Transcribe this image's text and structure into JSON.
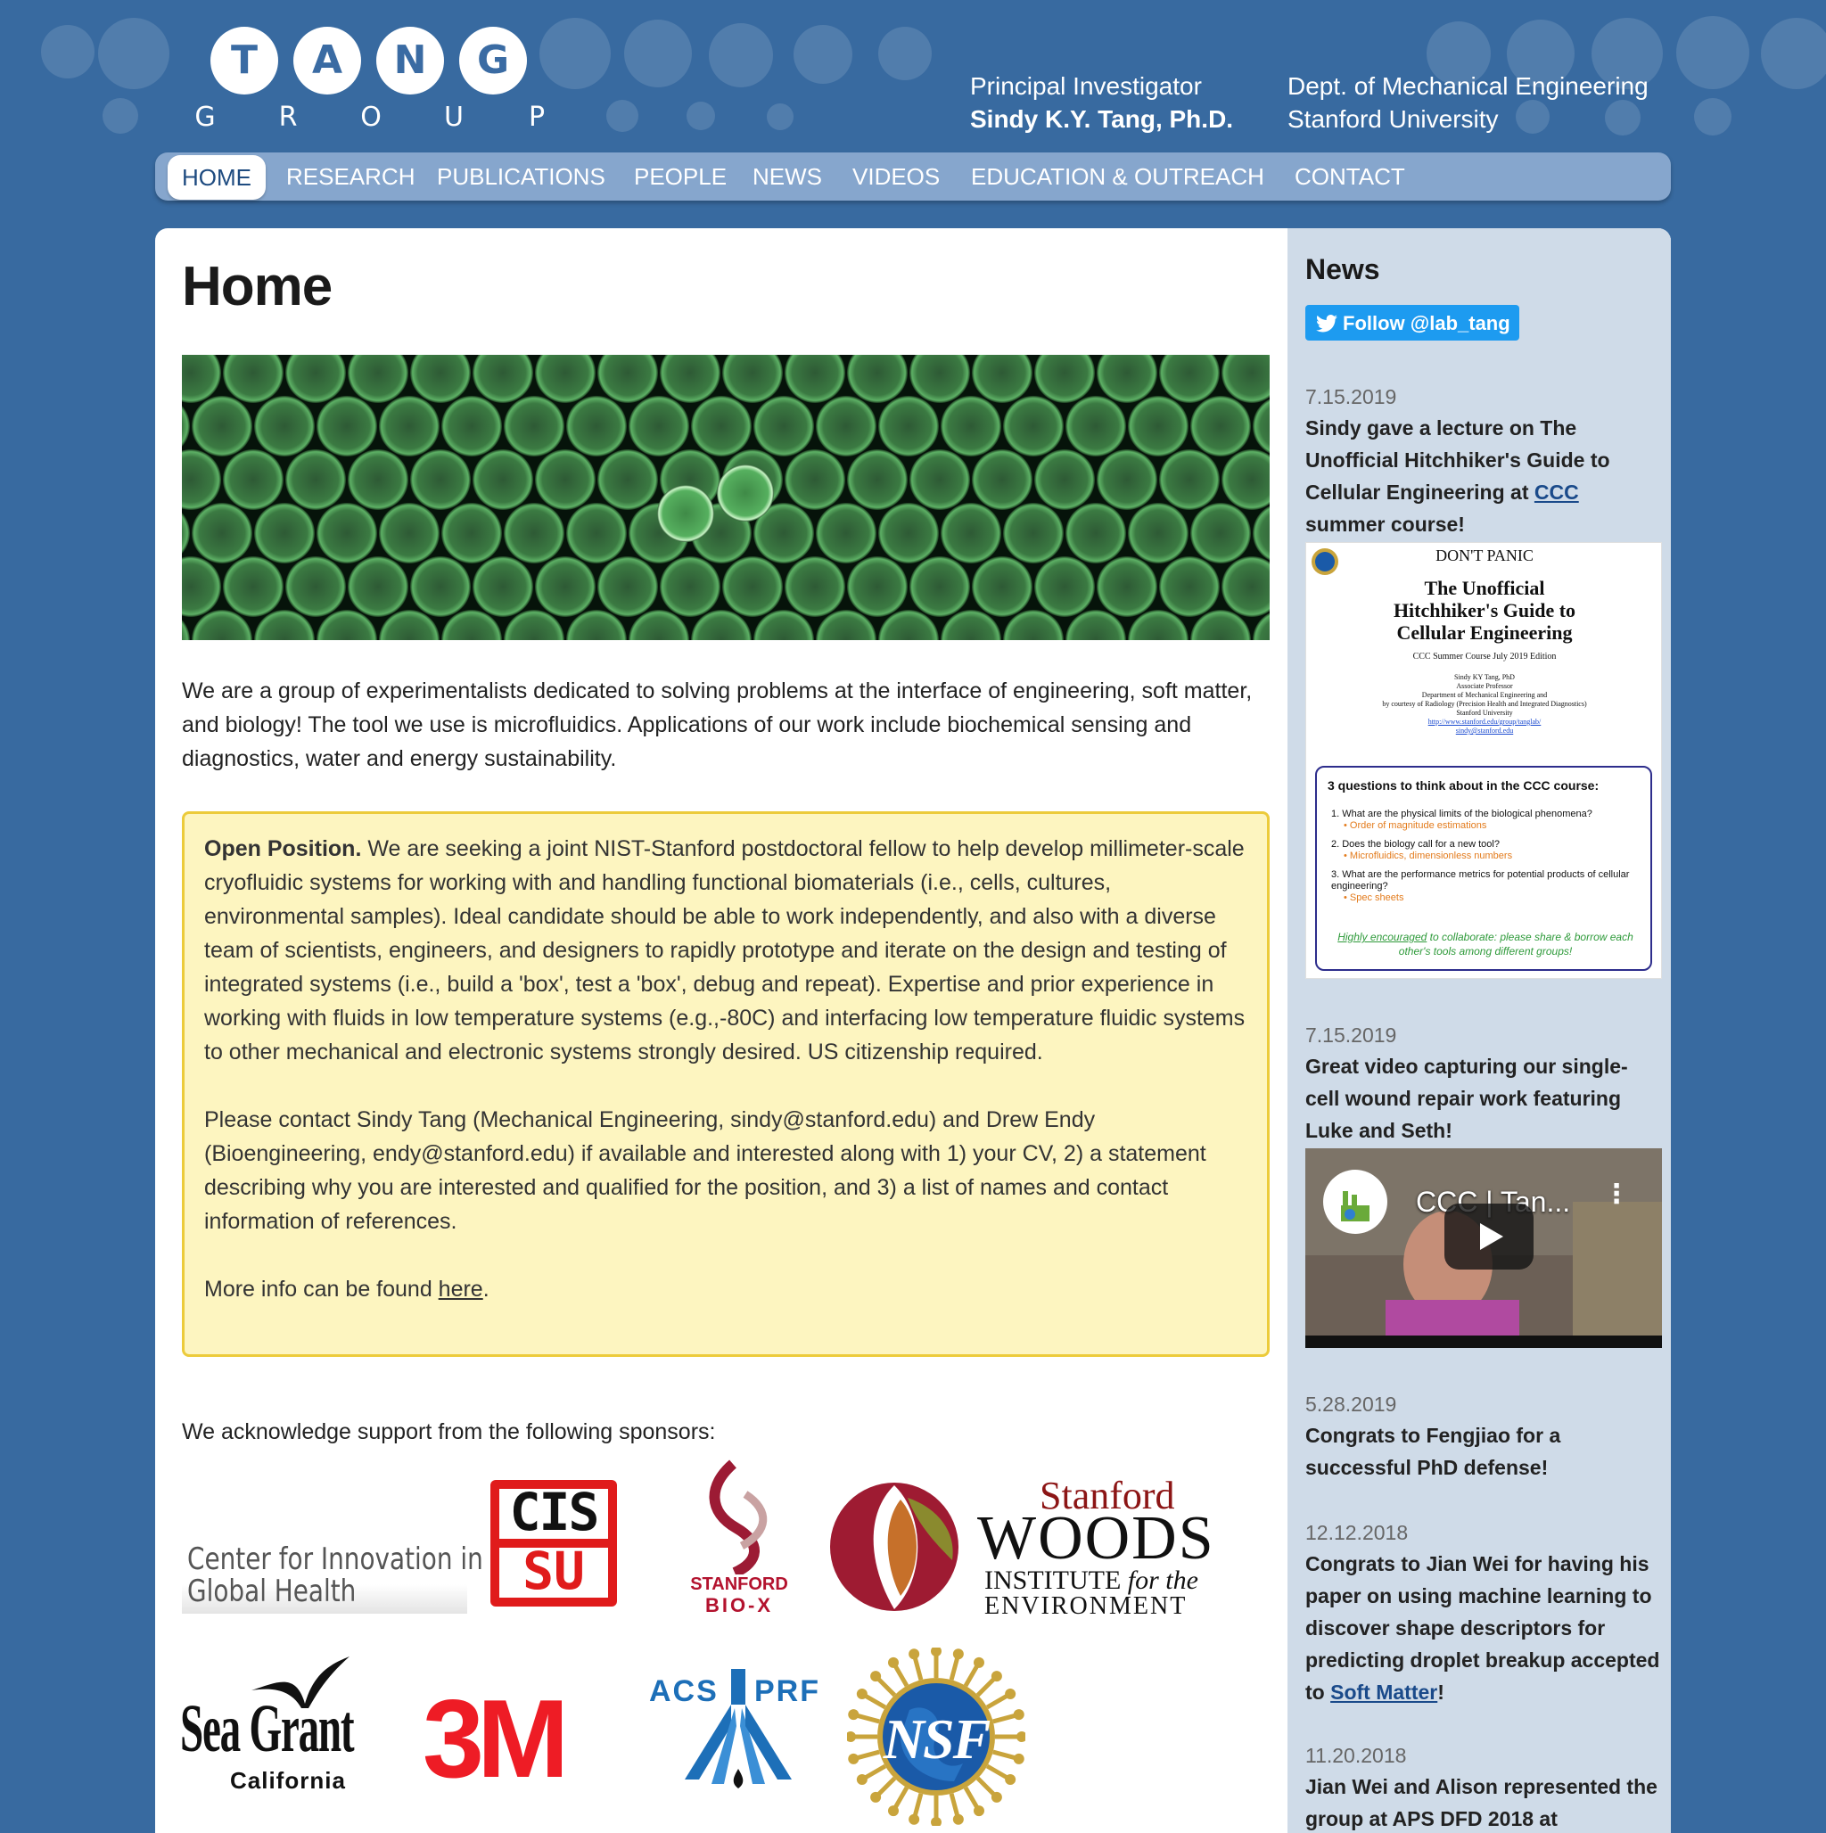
{
  "header": {
    "logo_letters": [
      "T",
      "A",
      "N",
      "G"
    ],
    "logo_sub_letters": [
      "G",
      "R",
      "O",
      "U",
      "P"
    ],
    "pi_label": "Principal Investigator",
    "pi_name": "Sindy K.Y. Tang, Ph.D.",
    "dept_line1": "Dept. of Mechanical Engineering",
    "dept_line2": "Stanford University"
  },
  "nav": {
    "items": [
      "HOME",
      "RESEARCH",
      "PUBLICATIONS",
      "PEOPLE",
      "NEWS",
      "VIDEOS",
      "EDUCATION & OUTREACH",
      "CONTACT"
    ],
    "active": "HOME"
  },
  "main": {
    "title": "Home",
    "intro": "We are a group of experimentalists dedicated to solving problems at the interface of engineering, soft matter, and biology! The tool we use is microfluidics. Applications of our work include biochemical sensing and diagnostics, water and energy sustainability.",
    "open_position": {
      "heading": "Open Position.",
      "para1": " We are seeking a joint NIST-Stanford postdoctoral fellow to help develop millimeter-scale cryofluidic systems for working with and handling functional biomaterials (i.e., cells, cultures, environmental samples). Ideal candidate should be able to work independently, and also with a diverse team of scientists, engineers, and designers to rapidly prototype and iterate on the design and testing of integrated systems (i.e., build a 'box', test a 'box', debug and repeat). Expertise and prior experience in working with fluids in low temperature systems (e.g.,-80C) and interfacing low temperature fluidic systems to other mechanical and electronic systems strongly desired. US citizenship required.",
      "para2": "Please contact Sindy Tang (Mechanical Engineering, sindy@stanford.edu) and Drew Endy (Bioengineering, endy@stanford.edu) if available and interested along with 1) your CV, 2) a statement describing why you are interested and qualified for the position, and 3) a list of names and contact information of references.",
      "more_prefix": "More info can be found ",
      "more_link": "here",
      "more_suffix": "."
    },
    "sponsors_intro": "We acknowledge support from the following sponsors:",
    "sponsors": {
      "cigh_line1": "Center for Innovation in",
      "cigh_line2": "Global Health",
      "cis_top": "CIS",
      "cis_bottom": "SU",
      "biox_line1": "STANFORD",
      "biox_line2": "BIO-X",
      "woods_line1": "Stanford",
      "woods_line2": "WOODS",
      "woods_line3a": "INSTITUTE ",
      "woods_line3b": "for the",
      "woods_line4": "ENVIRONMENT",
      "seagrant_line1": "Sea Grant",
      "seagrant_line2": "California",
      "threem": "3M",
      "acs_left": "ACS",
      "acs_right": "PRF",
      "nsf": "NSF"
    }
  },
  "sidebar": {
    "heading": "News",
    "follow_label": "Follow @lab_tang",
    "news": [
      {
        "date": "7.15.2019",
        "text_before": "Sindy gave a lecture on The Unofficial Hitchhiker's Guide to Cellular Engineering at ",
        "link": "CCC",
        "text_after": " summer course!"
      },
      {
        "date": "7.15.2019",
        "text": "Great video capturing our single-cell wound repair work featuring Luke and Seth!"
      },
      {
        "date": "5.28.2019",
        "text": "Congrats to Fengjiao for a successful PhD defense!"
      },
      {
        "date": "12.12.2018",
        "text_before": "Congrats to Jian Wei for having his paper on using machine learning to discover shape descriptors for predicting droplet breakup accepted to ",
        "link": "Soft Matter",
        "text_after": "!"
      },
      {
        "date": "11.20.2018",
        "text": "Jian Wei and Alison represented the group at APS DFD 2018 at"
      }
    ],
    "lecture_image": {
      "dont_panic": "DON'T PANIC",
      "title_line1": "The Unofficial",
      "title_line2": "Hitchhiker's Guide to",
      "title_line3": "Cellular Engineering",
      "edition": "CCC Summer Course July 2019 Edition",
      "author_lines": [
        "Sindy KY Tang, PhD",
        "Associate Professor",
        "Department of Mechanical Engineering and",
        "by courtesy of Radiology (Precision Health and Integrated Diagnostics)",
        "Stanford University"
      ],
      "url": "http://www.stanford.edu/group/tanglab/",
      "email": "sindy@stanford.edu",
      "q_heading": "3 questions to think about in the CCC course:",
      "q1": "1.  What are the physical limits of the biological phenomena?",
      "q1_sub": "• Order of magnitude estimations",
      "q2": "2.  Does the biology call for a new tool?",
      "q2_sub": "• Microfluidics, dimensionless numbers",
      "q3": "3.  What are the performance metrics for potential products of cellular engineering?",
      "q3_sub": "• Spec sheets",
      "footer_link": "Highly encouraged",
      "footer_rest": " to collaborate: please share & borrow each other's tools among different groups!"
    },
    "video": {
      "title": "CCC | Tan..."
    }
  },
  "colors": {
    "background": "#386aa0",
    "nav_bar": "#86a6cd",
    "sidebar": "#cfdbe8",
    "notice_bg": "#fdf5c0",
    "notice_border": "#eccb3b",
    "twitter": "#1d9bf0"
  }
}
